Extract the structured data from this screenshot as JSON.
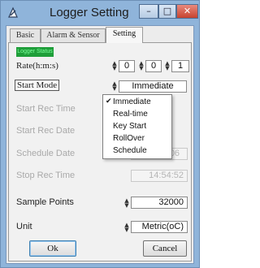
{
  "window": {
    "title": "Logger Setting",
    "min_label": "–",
    "max_label": "□",
    "close_label": "✕"
  },
  "tabs": [
    {
      "label": "Basic"
    },
    {
      "label": "Alarm & Sensor"
    },
    {
      "label": "Setting"
    }
  ],
  "active_tab": "Setting",
  "setting": {
    "status_badge": "Logger Status",
    "rate": {
      "label": "Rate(h:m:s)",
      "hours": "0",
      "minutes": "0",
      "seconds": "1"
    },
    "start_mode": {
      "label": "Start Mode",
      "value": "Immediate",
      "options": [
        "Immediate",
        "Real-time",
        "Key Start",
        "RollOver",
        "Schedule"
      ],
      "checked_mark": "✔"
    },
    "start_rec_time": {
      "label": "Start Rec Time"
    },
    "start_rec_date": {
      "label": "Start Rec Date"
    },
    "schedule_date": {
      "label": "Schedule Date",
      "value": "2018/12/06"
    },
    "stop_rec_time": {
      "label": "Stop Rec Time",
      "value": "14:54:52"
    },
    "sample_points": {
      "label": "Sample Points",
      "value": "32000"
    },
    "unit": {
      "label": "Unit",
      "value": "Metric(oC)"
    }
  },
  "buttons": {
    "ok": "Ok",
    "cancel": "Cancel"
  },
  "icons": {
    "app": "logger-app-icon",
    "spin": "spin-arrows-icon",
    "check": "checkmark-icon"
  }
}
